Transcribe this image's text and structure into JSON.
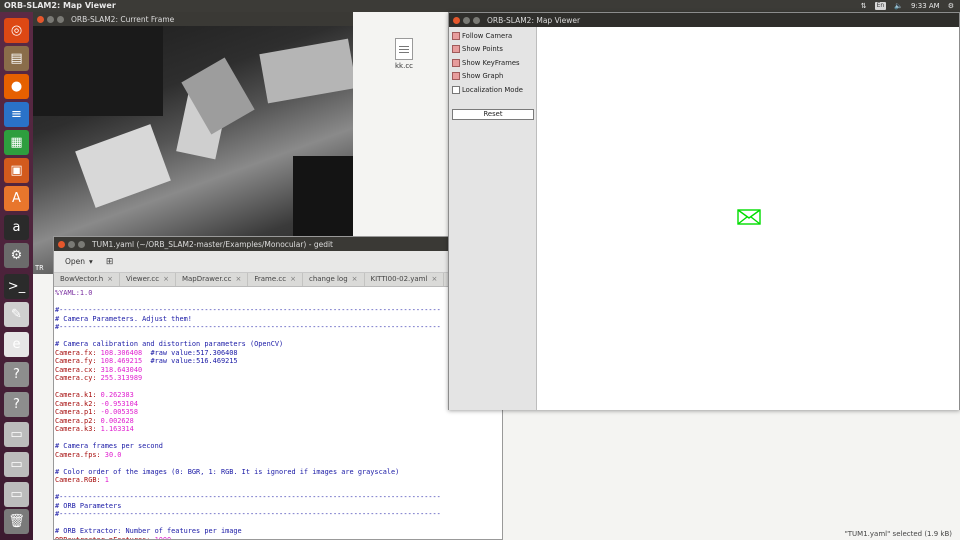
{
  "top_panel": {
    "app_title": "ORB-SLAM2: Map Viewer",
    "language": "En",
    "time": "9:33 AM"
  },
  "desktop": {
    "file_label": "kk.cc",
    "status_text": "\"TUM1.yaml\" selected (1.9 kB)"
  },
  "frame_window": {
    "title": "ORB-SLAM2: Current Frame",
    "overlay_text": "TR"
  },
  "gedit": {
    "title": "TUM1.yaml (~/ORB_SLAM2-master/Examples/Monocular) - gedit",
    "open_label": "Open",
    "tabs": [
      "BowVector.h",
      "Viewer.cc",
      "MapDrawer.cc",
      "Frame.cc",
      "change log",
      "KITTI00-02.yaml",
      "T"
    ],
    "lines": [
      {
        "cls": "c-yaml",
        "text": "%YAML:1.0"
      },
      {
        "cls": "",
        "text": ""
      },
      {
        "cls": "c-comment",
        "text": "#--------------------------------------------------------------------------------------------"
      },
      {
        "cls": "c-comment",
        "text": "# Camera Parameters. Adjust them!"
      },
      {
        "cls": "c-comment",
        "text": "#--------------------------------------------------------------------------------------------"
      },
      {
        "cls": "",
        "text": ""
      },
      {
        "cls": "c-comment",
        "text": "# Camera calibration and distortion parameters (OpenCV)"
      },
      {
        "key": "Camera.fx: ",
        "val": "108.306408",
        "tail": "  #raw value:517.306408"
      },
      {
        "key": "Camera.fy: ",
        "val": "108.469215",
        "tail": "  #raw value:516.469215"
      },
      {
        "key": "Camera.cx: ",
        "val": "318.643040",
        "tail": ""
      },
      {
        "key": "Camera.cy: ",
        "val": "255.313989",
        "tail": ""
      },
      {
        "cls": "",
        "text": ""
      },
      {
        "key": "Camera.k1: ",
        "val": "0.262383",
        "tail": ""
      },
      {
        "key": "Camera.k2: ",
        "val": "-0.953104",
        "tail": ""
      },
      {
        "key": "Camera.p1: ",
        "val": "-0.005358",
        "tail": ""
      },
      {
        "key": "Camera.p2: ",
        "val": "0.002628",
        "tail": ""
      },
      {
        "key": "Camera.k3: ",
        "val": "1.163314",
        "tail": ""
      },
      {
        "cls": "",
        "text": ""
      },
      {
        "cls": "c-comment",
        "text": "# Camera frames per second"
      },
      {
        "key": "Camera.fps: ",
        "val": "30.0",
        "tail": ""
      },
      {
        "cls": "",
        "text": ""
      },
      {
        "cls": "c-comment",
        "text": "# Color order of the images (0: BGR, 1: RGB. It is ignored if images are grayscale)"
      },
      {
        "key": "Camera.RGB: ",
        "val": "1",
        "tail": ""
      },
      {
        "cls": "",
        "text": ""
      },
      {
        "cls": "c-comment",
        "text": "#--------------------------------------------------------------------------------------------"
      },
      {
        "cls": "c-comment",
        "text": "# ORB Parameters"
      },
      {
        "cls": "c-comment",
        "text": "#--------------------------------------------------------------------------------------------"
      },
      {
        "cls": "",
        "text": ""
      },
      {
        "cls": "c-comment",
        "text": "# ORB Extractor: Number of features per image"
      },
      {
        "key": "ORBextractor.nFeatures: ",
        "val": "1000",
        "tail": ""
      }
    ]
  },
  "map_viewer": {
    "title": "ORB-SLAM2: Map Viewer",
    "options": [
      {
        "label": "Follow Camera",
        "checked": true
      },
      {
        "label": "Show Points",
        "checked": true
      },
      {
        "label": "Show KeyFrames",
        "checked": true
      },
      {
        "label": "Show Graph",
        "checked": true
      },
      {
        "label": "Localization Mode",
        "checked": false
      }
    ],
    "reset_label": "Reset",
    "camera_color": "#00dd00"
  },
  "launcher": {
    "items": [
      {
        "icon": "ubuntu-logo-icon",
        "glyph": "◎",
        "bg": "#dd4814"
      },
      {
        "icon": "files-icon",
        "glyph": "▤",
        "bg": "#8a6d4a"
      },
      {
        "icon": "firefox-icon",
        "glyph": "●",
        "bg": "#e66000"
      },
      {
        "icon": "writer-icon",
        "glyph": "≡",
        "bg": "#2a72c8"
      },
      {
        "icon": "calc-icon",
        "glyph": "▦",
        "bg": "#2e9e3e"
      },
      {
        "icon": "impress-icon",
        "glyph": "▣",
        "bg": "#d25a1d"
      },
      {
        "icon": "software-center-icon",
        "glyph": "A",
        "bg": "#e8762c"
      },
      {
        "icon": "amazon-icon",
        "glyph": "a",
        "bg": "#2a2a2a"
      },
      {
        "icon": "settings-icon",
        "glyph": "⚙",
        "bg": "#6b6b6b"
      },
      {
        "icon": "terminal-icon",
        "glyph": ">_",
        "bg": "#2b2b2b"
      },
      {
        "icon": "text-editor-icon",
        "glyph": "✎",
        "bg": "#cfcfcf"
      },
      {
        "icon": "document-viewer-icon",
        "glyph": "e",
        "bg": "#e6e6e6"
      },
      {
        "icon": "unknown-app-icon",
        "glyph": "?",
        "bg": "#8d8d8d"
      },
      {
        "icon": "unknown-app-icon-2",
        "glyph": "?",
        "bg": "#8d8d8d"
      },
      {
        "icon": "drive-icon",
        "glyph": "▭",
        "bg": "#bcbcbc"
      },
      {
        "icon": "drive-icon-2",
        "glyph": "▭",
        "bg": "#bcbcbc"
      },
      {
        "icon": "drive-icon-3",
        "glyph": "▭",
        "bg": "#bcbcbc"
      },
      {
        "icon": "trash-icon",
        "glyph": "🗑",
        "bg": "#7a7a7a"
      }
    ]
  }
}
